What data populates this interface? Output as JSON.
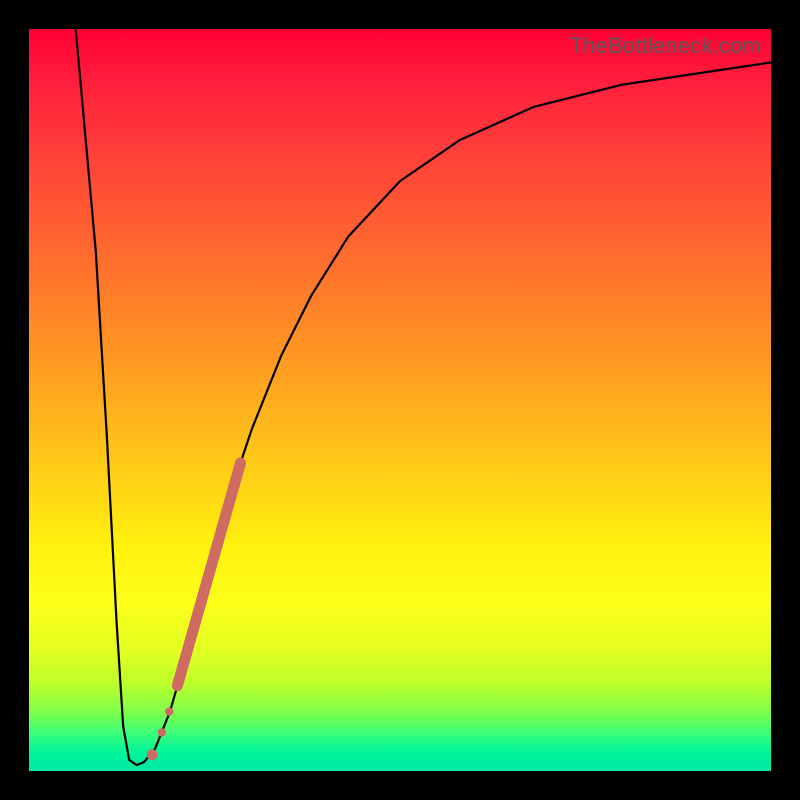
{
  "watermark": "TheBottleneck.com",
  "chart_data": {
    "type": "line",
    "title": "",
    "xlabel": "",
    "ylabel": "",
    "xlim": [
      0,
      100
    ],
    "ylim": [
      0,
      100
    ],
    "grid": false,
    "curve": [
      {
        "x": 6.3,
        "y": 100.0
      },
      {
        "x": 9.0,
        "y": 70.0
      },
      {
        "x": 10.5,
        "y": 45.0
      },
      {
        "x": 11.8,
        "y": 20.0
      },
      {
        "x": 12.7,
        "y": 6.0
      },
      {
        "x": 13.5,
        "y": 1.5
      },
      {
        "x": 14.5,
        "y": 0.8
      },
      {
        "x": 15.5,
        "y": 1.2
      },
      {
        "x": 17.0,
        "y": 3.0
      },
      {
        "x": 19.0,
        "y": 8.0
      },
      {
        "x": 21.0,
        "y": 15.0
      },
      {
        "x": 23.0,
        "y": 23.0
      },
      {
        "x": 25.0,
        "y": 30.0
      },
      {
        "x": 27.0,
        "y": 37.0
      },
      {
        "x": 30.0,
        "y": 46.0
      },
      {
        "x": 34.0,
        "y": 56.0
      },
      {
        "x": 38.0,
        "y": 64.0
      },
      {
        "x": 43.0,
        "y": 72.0
      },
      {
        "x": 50.0,
        "y": 79.5
      },
      {
        "x": 58.0,
        "y": 85.0
      },
      {
        "x": 68.0,
        "y": 89.5
      },
      {
        "x": 80.0,
        "y": 92.5
      },
      {
        "x": 100.0,
        "y": 95.5
      }
    ],
    "highlight_segment": [
      {
        "x": 20.0,
        "y": 11.5
      },
      {
        "x": 28.5,
        "y": 41.5
      }
    ],
    "highlight_dots": [
      {
        "x": 18.9,
        "y": 8.0,
        "r": 4.2
      },
      {
        "x": 17.9,
        "y": 5.2,
        "r": 4.2
      },
      {
        "x": 16.6,
        "y": 2.2,
        "r": 5.4
      }
    ],
    "background_gradient": {
      "top": "#ff0033",
      "upper_mid": "#ff9a22",
      "mid": "#fff20e",
      "lower_mid": "#7fff4a",
      "bottom": "#00e8a4"
    }
  }
}
